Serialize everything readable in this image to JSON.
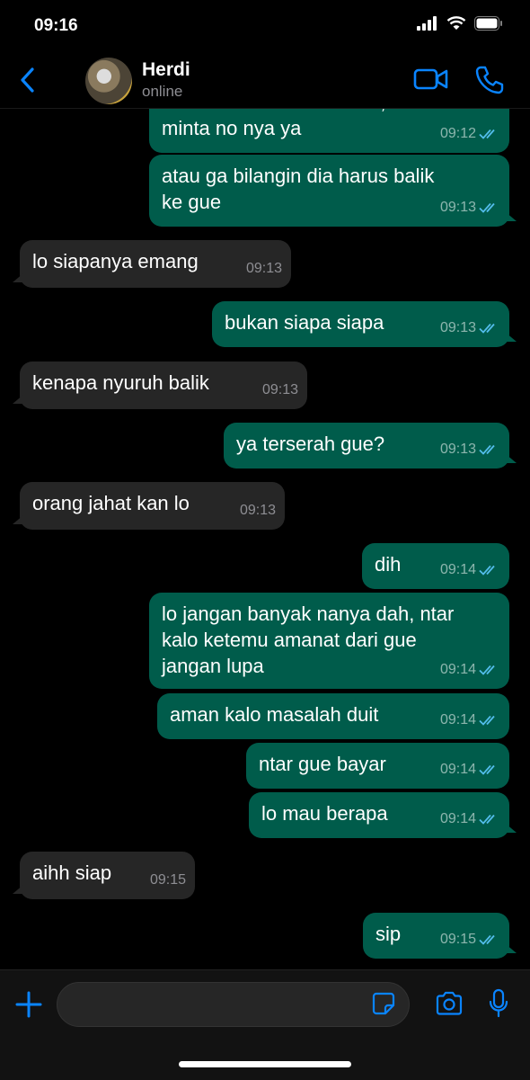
{
  "status_bar": {
    "time": "09:16"
  },
  "contact": {
    "name": "Herdi",
    "status": "online"
  },
  "composer": {
    "placeholder": ""
  },
  "colors": {
    "accent": "#0a84ff",
    "outgoing": "#005c4b",
    "incoming": "#262626",
    "read_tick": "#53bdeb"
  },
  "messages": [
    {
      "dir": "out",
      "text": "kalo lo ketemu sama ami, lo\nminta no nya ya",
      "time": "09:12"
    },
    {
      "dir": "out",
      "text": "atau ga bilangin dia harus balik\nke gue",
      "time": "09:13"
    },
    {
      "dir": "in",
      "text": "lo siapanya emang",
      "time": "09:13"
    },
    {
      "dir": "out",
      "text": "bukan siapa siapa",
      "time": "09:13"
    },
    {
      "dir": "in",
      "text": "kenapa nyuruh balik",
      "time": "09:13"
    },
    {
      "dir": "out",
      "text": "ya terserah gue?",
      "time": "09:13"
    },
    {
      "dir": "in",
      "text": "orang jahat kan lo",
      "time": "09:13"
    },
    {
      "dir": "out",
      "text": "dih",
      "time": "09:14"
    },
    {
      "dir": "out",
      "text": "lo jangan banyak nanya dah, ntar\nkalo ketemu amanat dari gue\njangan lupa",
      "time": "09:14"
    },
    {
      "dir": "out",
      "text": "aman kalo masalah duit",
      "time": "09:14"
    },
    {
      "dir": "out",
      "text": "ntar gue bayar",
      "time": "09:14"
    },
    {
      "dir": "out",
      "text": "lo mau berapa",
      "time": "09:14"
    },
    {
      "dir": "in",
      "text": "aihh siap",
      "time": "09:15"
    },
    {
      "dir": "out",
      "text": "sip",
      "time": "09:15"
    }
  ]
}
